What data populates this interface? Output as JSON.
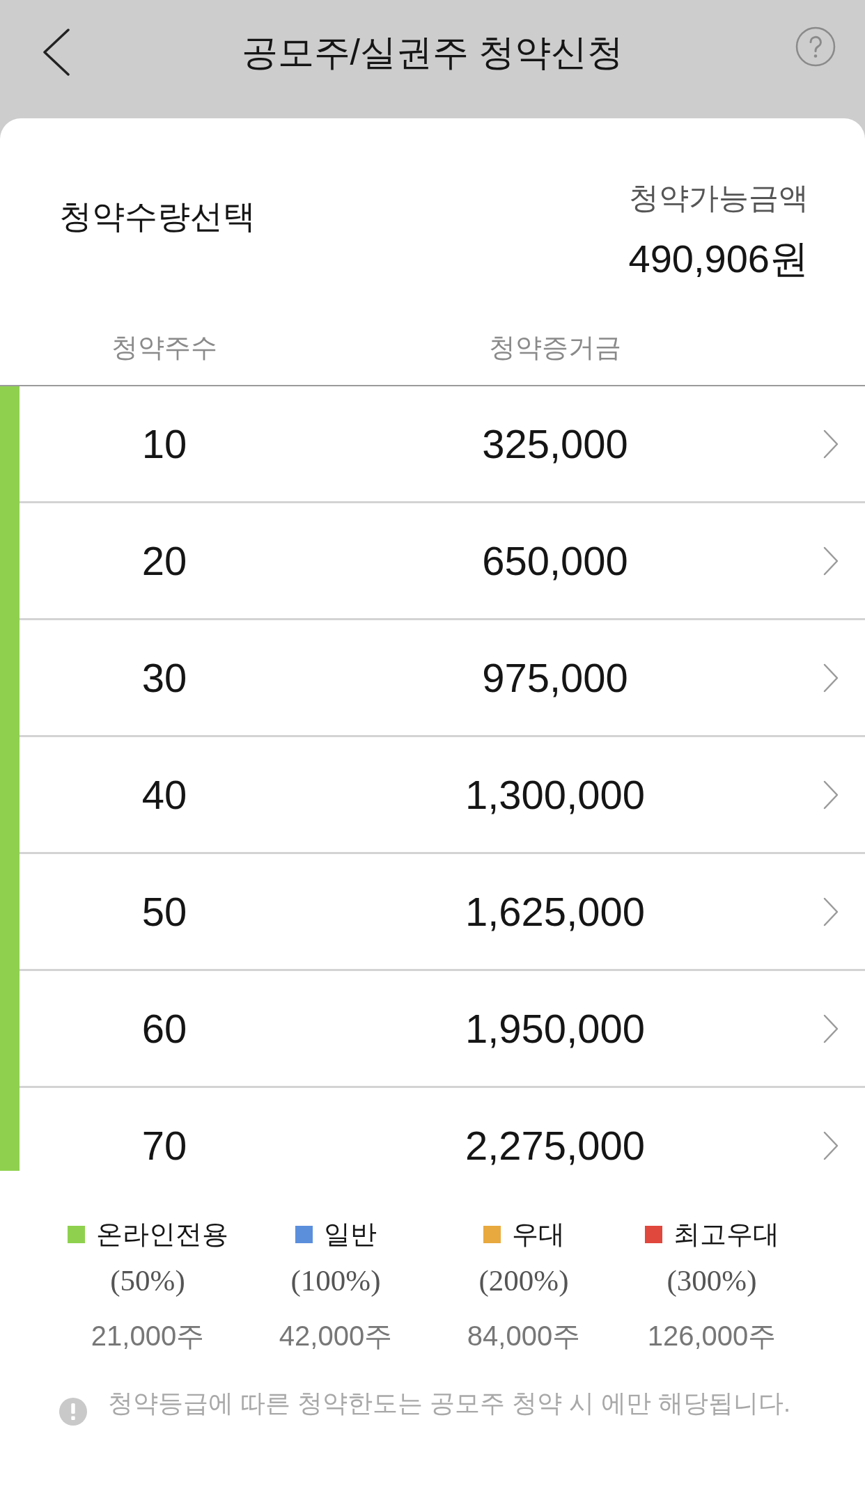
{
  "header": {
    "title": "공모주/실권주 청약신청"
  },
  "summary": {
    "title": "청약수량선택",
    "available_label": "청약가능금액",
    "available_amount": "490,906원"
  },
  "table": {
    "columns": [
      "청약주수",
      "청약증거금"
    ],
    "rows": [
      {
        "shares": "10",
        "deposit": "325,000",
        "color": "#8fd14f"
      },
      {
        "shares": "20",
        "deposit": "650,000",
        "color": "#8fd14f"
      },
      {
        "shares": "30",
        "deposit": "975,000",
        "color": "#8fd14f"
      },
      {
        "shares": "40",
        "deposit": "1,300,000",
        "color": "#8fd14f"
      },
      {
        "shares": "50",
        "deposit": "1,625,000",
        "color": "#8fd14f"
      },
      {
        "shares": "60",
        "deposit": "1,950,000",
        "color": "#8fd14f"
      },
      {
        "shares": "70",
        "deposit": "2,275,000",
        "color": "#8fd14f"
      }
    ]
  },
  "legend": [
    {
      "label": "온라인전용",
      "rate": "(50%)",
      "limit": "21,000주",
      "color": "#8fd14f"
    },
    {
      "label": "일반",
      "rate": "(100%)",
      "limit": "42,000주",
      "color": "#5b8fdc"
    },
    {
      "label": "우대",
      "rate": "(200%)",
      "limit": "84,000주",
      "color": "#e8a93e"
    },
    {
      "label": "최고우대",
      "rate": "(300%)",
      "limit": "126,000주",
      "color": "#e0473d"
    }
  ],
  "note": "청약등급에 따른 청약한도는 공모주 청약 시 에만 해당됩니다."
}
